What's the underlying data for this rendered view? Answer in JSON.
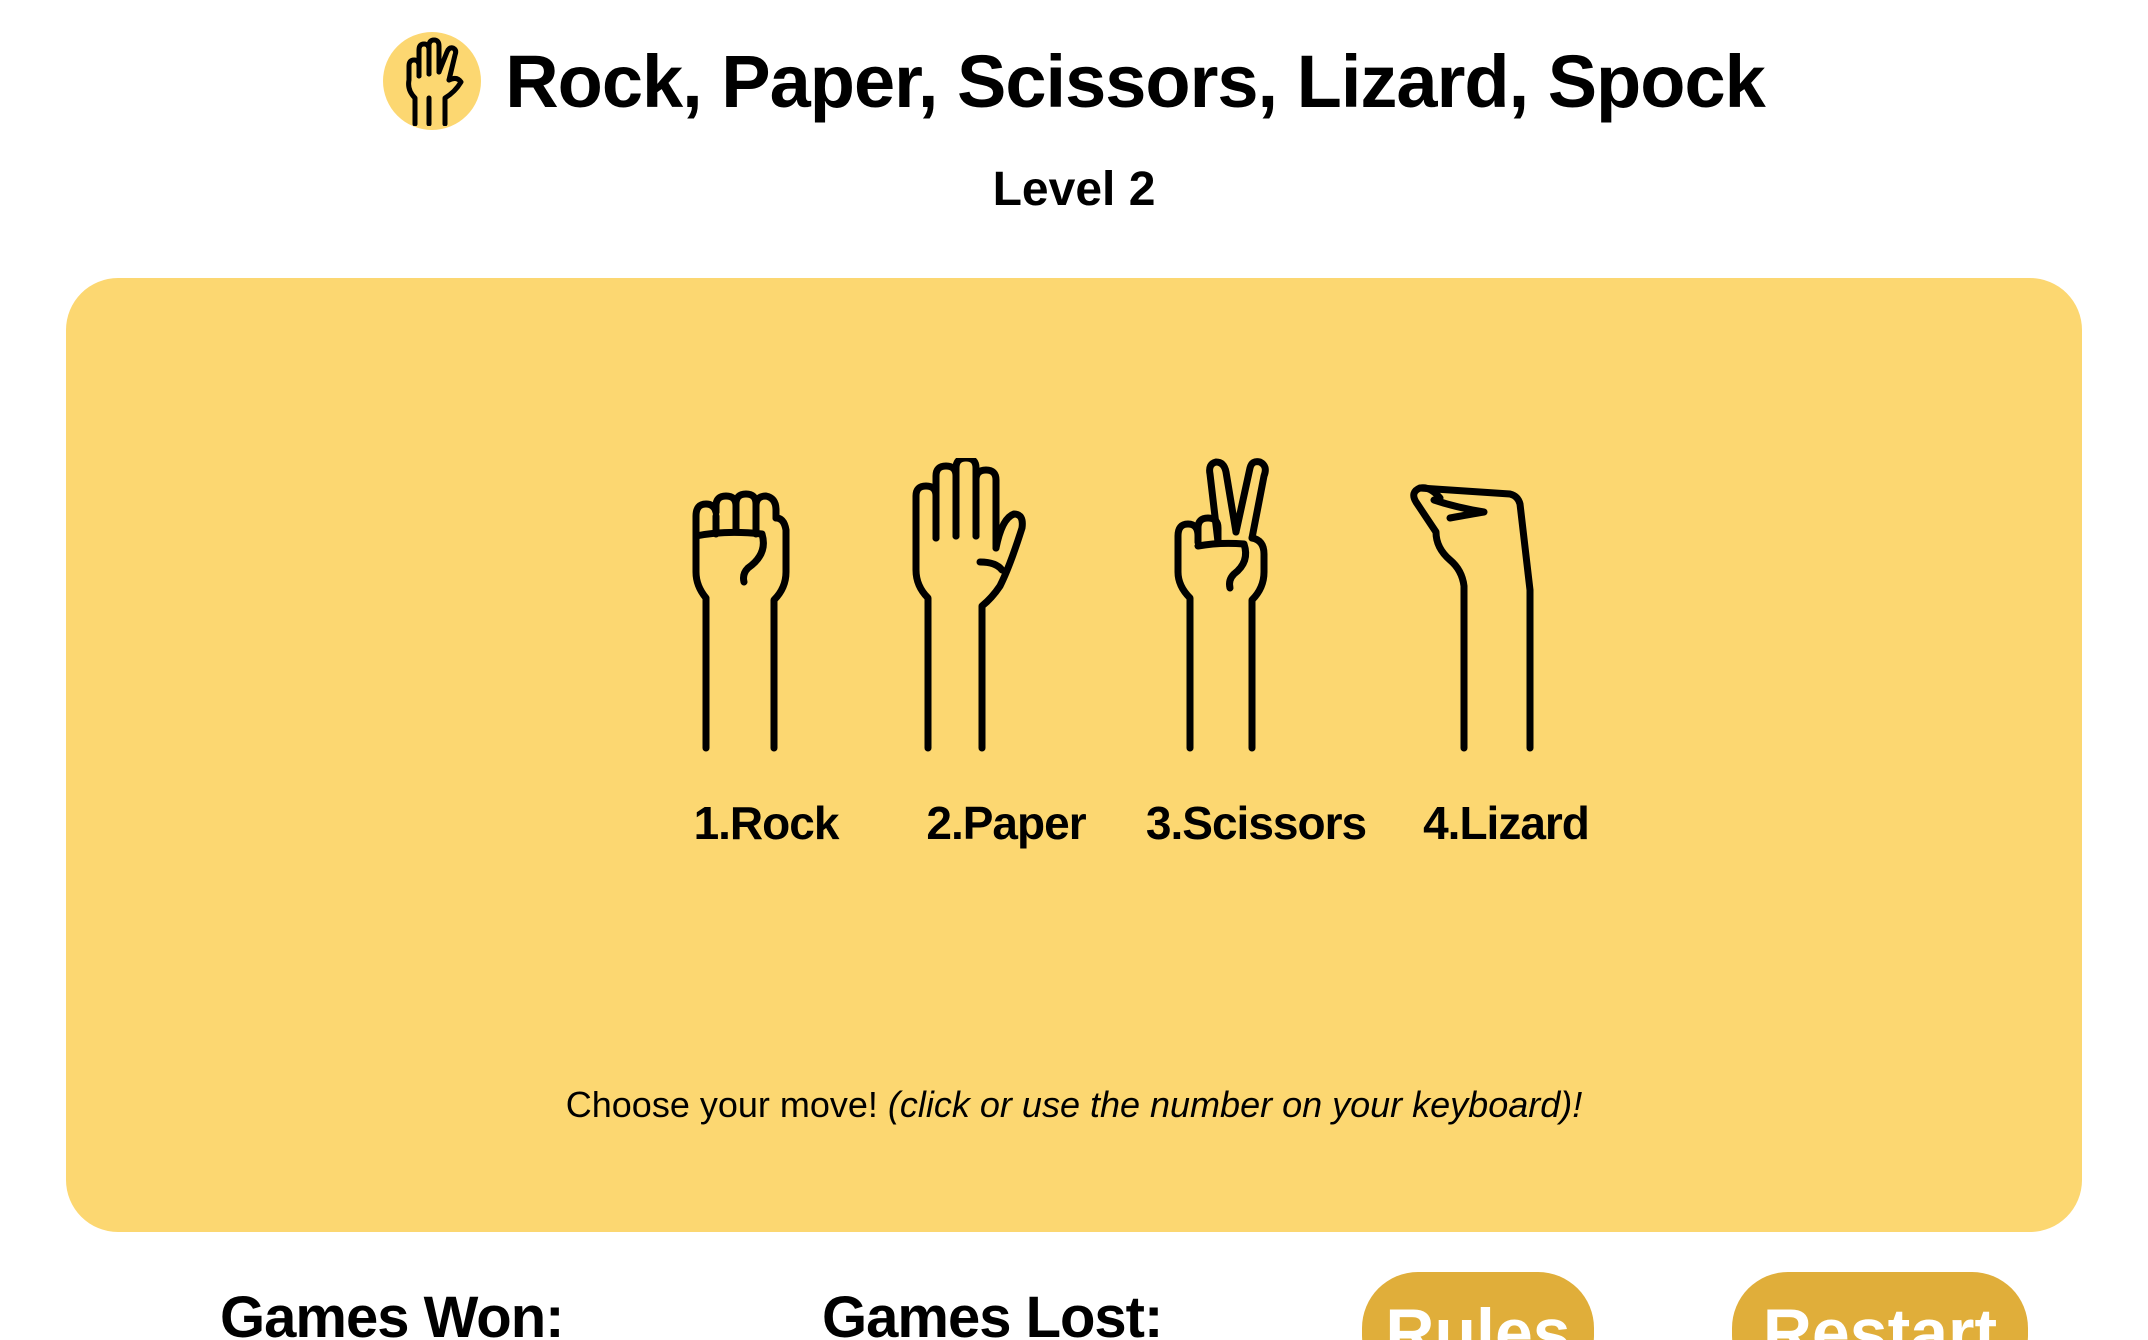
{
  "header": {
    "title": "Rock, Paper, Scissors, Lizard, Spock",
    "level": "Level 2"
  },
  "board": {
    "moves": [
      {
        "label": "1.Rock",
        "icon": "rock-hand-icon"
      },
      {
        "label": "2.Paper",
        "icon": "paper-hand-icon"
      },
      {
        "label": "3.Scissors",
        "icon": "scissors-hand-icon"
      },
      {
        "label": "4.Lizard",
        "icon": "lizard-hand-icon"
      }
    ],
    "prompt_main": "Choose your move!",
    "prompt_hint": "(click or use the number on your keyboard)!"
  },
  "footer": {
    "games_won_label": "Games Won:",
    "games_lost_label": "Games Lost:",
    "rules_button": "Rules",
    "restart_button": "Restart"
  },
  "colors": {
    "board_bg": "#fcd771",
    "button_bg": "#e0ae3a",
    "button_text": "#ffffff"
  }
}
